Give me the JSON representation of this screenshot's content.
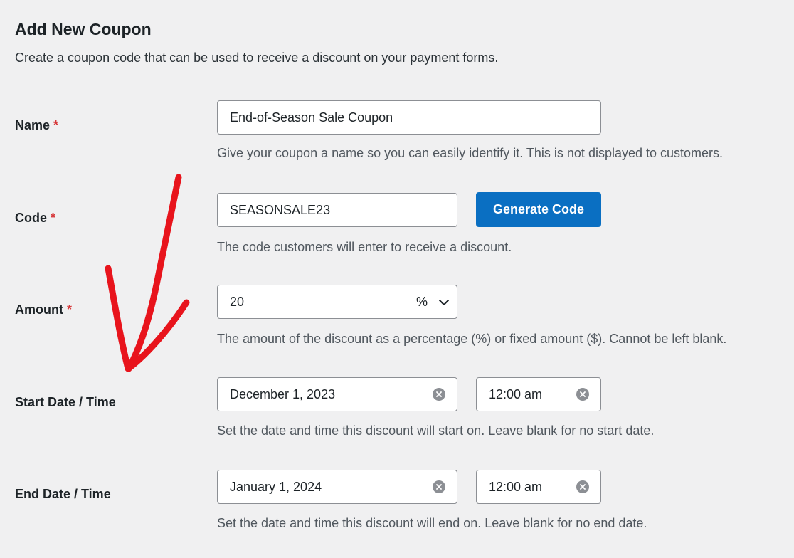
{
  "header": {
    "title": "Add New Coupon",
    "description": "Create a coupon code that can be used to receive a discount on your payment forms."
  },
  "fields": {
    "name": {
      "label": "Name",
      "required_mark": "*",
      "value": "End-of-Season Sale Coupon",
      "help": "Give your coupon a name so you can easily identify it. This is not displayed to customers."
    },
    "code": {
      "label": "Code",
      "required_mark": "*",
      "value": "SEASONSALE23",
      "button_label": "Generate Code",
      "help": "The code customers will enter to receive a discount."
    },
    "amount": {
      "label": "Amount",
      "required_mark": "*",
      "value": "20",
      "type_selected": "%",
      "help": "The amount of the discount as a percentage (%) or fixed amount ($). Cannot be left blank."
    },
    "start": {
      "label": "Start Date / Time",
      "date": "December 1, 2023",
      "time": "12:00 am",
      "help": "Set the date and time this discount will start on. Leave blank for no start date."
    },
    "end": {
      "label": "End Date / Time",
      "date": "January 1, 2024",
      "time": "12:00 am",
      "help": "Set the date and time this discount will end on. Leave blank for no end date."
    }
  },
  "colors": {
    "background": "#f0f0f1",
    "primary_button": "#0a6fc2",
    "required_star": "#d63638",
    "annotation_arrow": "#e8141c"
  },
  "icons": {
    "clear": "clear-circle-icon",
    "dropdown": "chevron-down-icon",
    "annotation": "red-arrow-annotation"
  }
}
